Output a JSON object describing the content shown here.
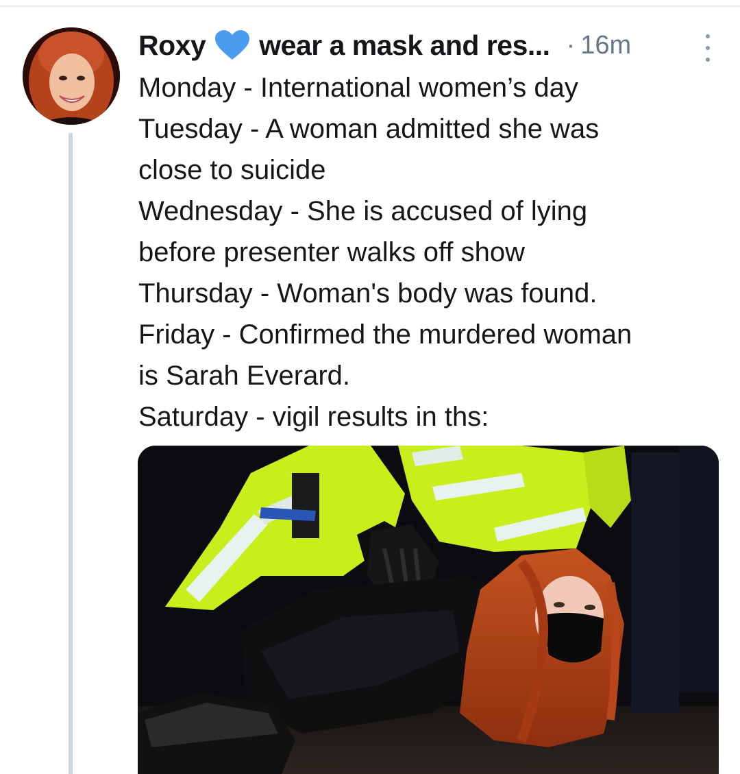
{
  "tweet": {
    "author": {
      "display_name": "Roxy",
      "display_name_suffix": "wear a mask and res...",
      "heart_color": "#4a9cf0"
    },
    "timestamp": "16m",
    "text_lines": [
      "Monday - International women’s day",
      "Tuesday - A woman admitted she was",
      "close to suicide",
      "Wednesday - She is accused of lying",
      "before presenter walks off show",
      "Thursday - Woman's body was found.",
      "Friday - Confirmed the murdered woman",
      "is Sarah Everard.",
      "Saturday - vigil results in ths:"
    ],
    "media": {
      "kind": "photo"
    }
  },
  "colors": {
    "text": "#14171a",
    "secondary_text": "#657786",
    "thread_line": "#ccd6dd",
    "hi_vis": "#c8ef1c"
  }
}
